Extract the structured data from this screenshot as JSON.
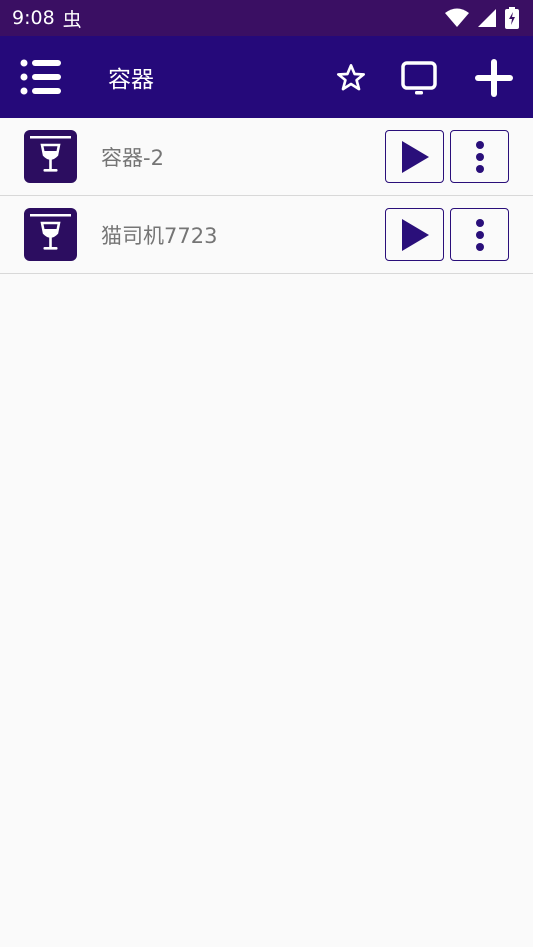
{
  "status_bar": {
    "time": "9:08",
    "notification_glyph": "虫",
    "icons": [
      "wifi-icon",
      "signal-icon",
      "battery-charging-icon"
    ]
  },
  "app_bar": {
    "title": "容器",
    "icons": [
      "menu-list-icon",
      "star-outline-icon",
      "monitor-icon",
      "plus-icon"
    ]
  },
  "containers": [
    {
      "label": "容器-2",
      "icon": "wine-glass-box-icon"
    },
    {
      "label": "猫司机7723",
      "icon": "wine-glass-box-icon"
    }
  ],
  "colors": {
    "status_bar": "#3a0f63",
    "app_bar": "#25097a",
    "accent": "#2a0f7a",
    "row_icon_bg": "#2c0d60",
    "label_text": "#757575"
  }
}
